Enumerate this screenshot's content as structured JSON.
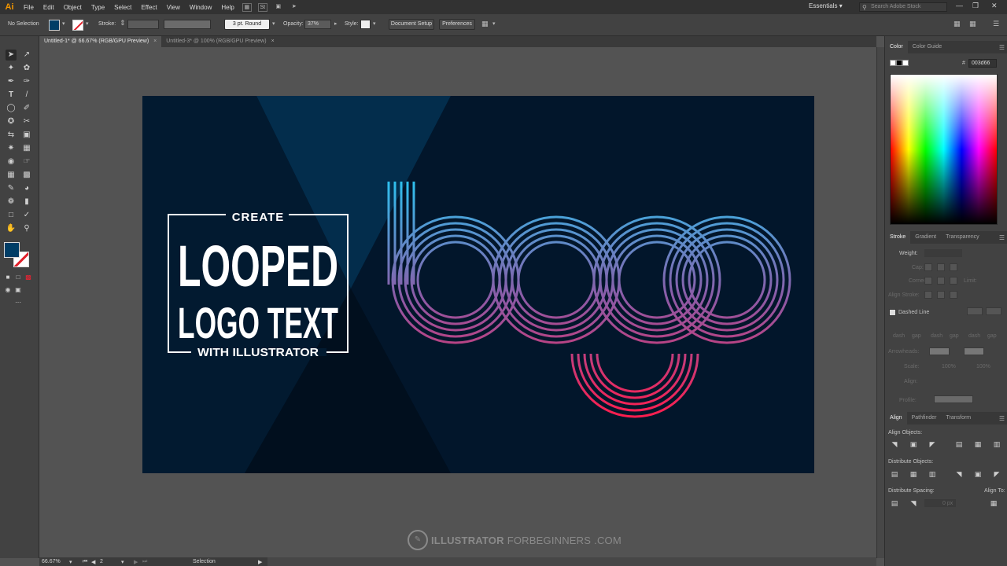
{
  "app": {
    "logo": "Ai"
  },
  "menu": {
    "items": [
      "File",
      "Edit",
      "Object",
      "Type",
      "Select",
      "Effect",
      "View",
      "Window",
      "Help"
    ],
    "workspace": "Essentials",
    "search_placeholder": "Search Adobe Stock",
    "st_label": "St"
  },
  "control": {
    "selection": "No Selection",
    "stroke_label": "Stroke:",
    "brush": "3 pt. Round",
    "opacity_label": "Opacity:",
    "opacity_value": "37%",
    "style_label": "Style:",
    "doc_setup": "Document Setup",
    "preferences": "Preferences"
  },
  "tabs": [
    {
      "label": "Untitled-1* @ 66.67% (RGB/GPU Preview)",
      "active": true
    },
    {
      "label": "Untitled-3* @ 100% (RGB/GPU Preview)",
      "active": false
    }
  ],
  "artwork": {
    "line1": "CREATE",
    "line2": "LOOPED",
    "line3": "LOGO TEXT",
    "line4": "WITH ILLUSTRATOR",
    "bg_color": "#02172c",
    "gradient_top": "#2bc3f0",
    "gradient_bottom": "#ff1d4d"
  },
  "watermark": {
    "bold": "ILLUSTRATOR",
    "thin": "FORBEGINNERS",
    "suffix": ".COM"
  },
  "status": {
    "zoom": "66.67%",
    "page": "2",
    "tool": "Selection"
  },
  "panels": {
    "color": {
      "tab": "Color",
      "tab2": "Color Guide",
      "hex": "003d66"
    },
    "stroke": {
      "tabs": [
        "Stroke",
        "Gradient",
        "Transparency"
      ],
      "weight_label": "Weight:",
      "cap": "Cap:",
      "corner": "Corner:",
      "limit": "Limit:",
      "align_stroke": "Align Stroke:",
      "dashed": "Dashed Line",
      "dash_labels": [
        "dash",
        "gap",
        "dash",
        "gap",
        "dash",
        "gap"
      ],
      "arrowheads": "Arrowheads:",
      "scale": "Scale:",
      "scale_val1": "100%",
      "scale_val2": "100%",
      "align": "Align:",
      "profile": "Profile:"
    },
    "align": {
      "tabs": [
        "Align",
        "Pathfinder",
        "Transform"
      ],
      "align_objects": "Align Objects:",
      "distribute_objects": "Distribute Objects:",
      "distribute_spacing": "Distribute Spacing:",
      "align_to": "Align To:",
      "spacing_value": "0 px"
    }
  }
}
